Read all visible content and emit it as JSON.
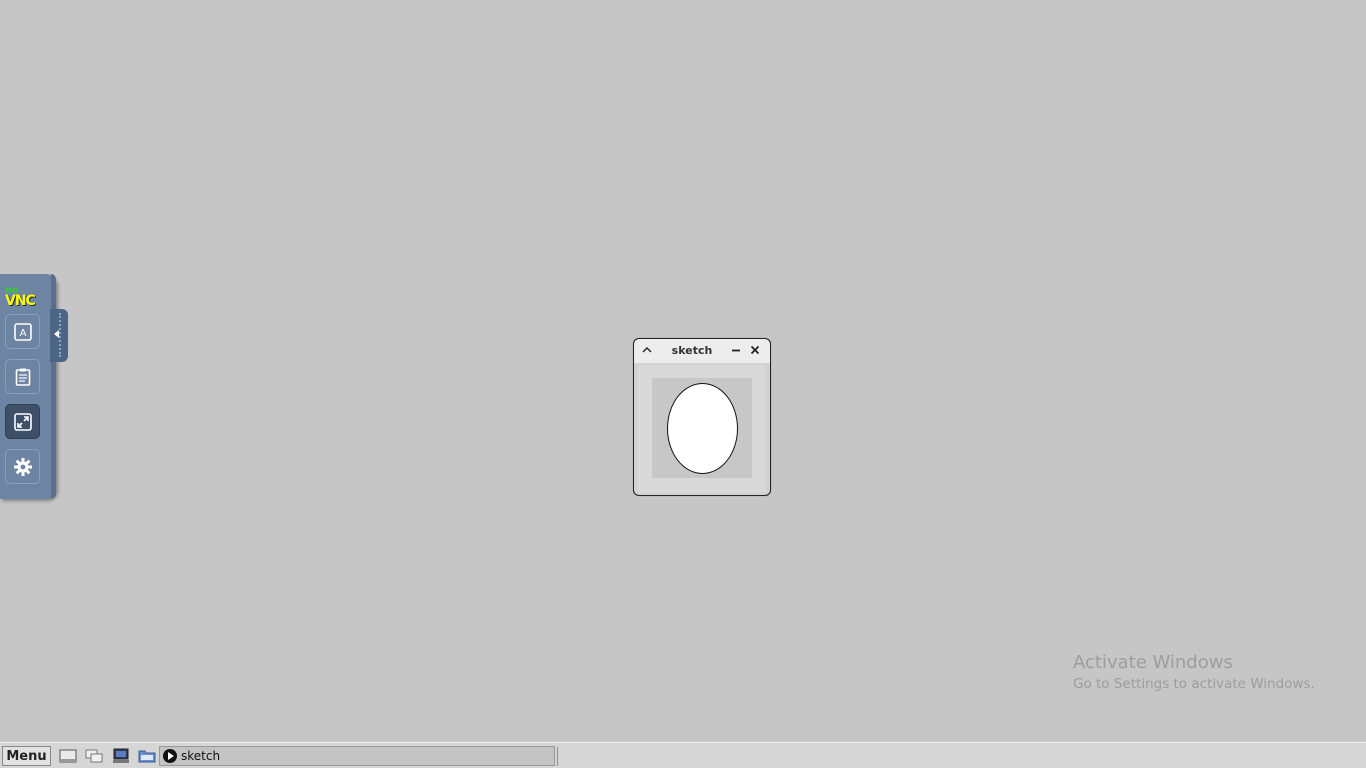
{
  "novnc": {
    "logo_top": "no",
    "logo_bottom": "VNC",
    "buttons": [
      {
        "name": "keyboard-icon"
      },
      {
        "name": "clipboard-icon"
      },
      {
        "name": "fullscreen-icon",
        "active": true
      },
      {
        "name": "settings-gear-icon"
      }
    ]
  },
  "sketch_window": {
    "title": "sketch"
  },
  "watermark": {
    "line1": "Activate Windows",
    "line2": "Go to Settings to activate Windows."
  },
  "taskbar": {
    "menu_label": "Menu",
    "launchers": [
      "show-desktop-icon",
      "window-switcher-icon",
      "terminal-icon",
      "file-manager-icon"
    ],
    "tasks": [
      {
        "label": "sketch",
        "icon": "app-icon"
      }
    ]
  },
  "colors": {
    "desktop": "#c6c6c6",
    "novnc_panel": "#6e84a3",
    "novnc_active": "#3d5068"
  }
}
